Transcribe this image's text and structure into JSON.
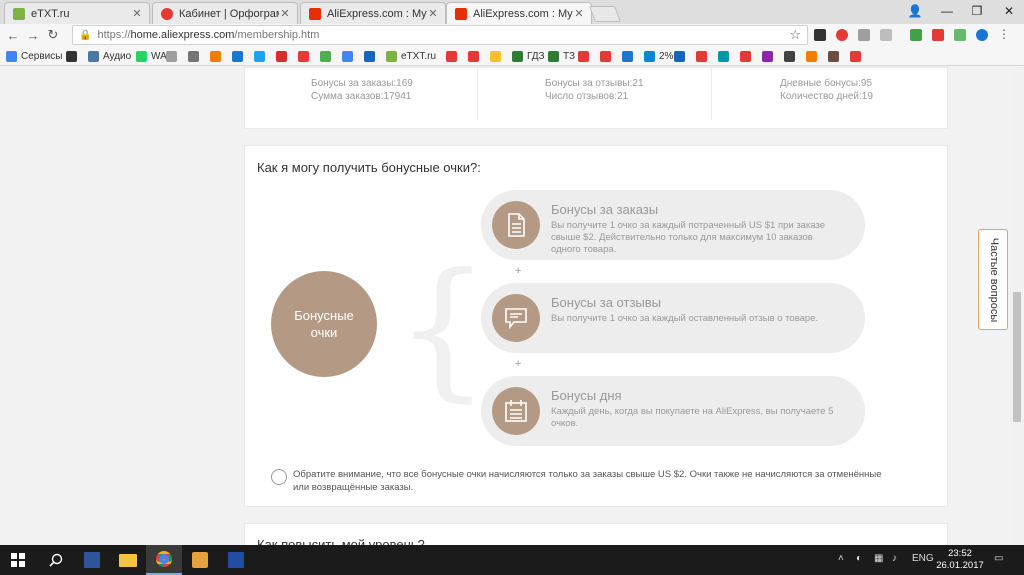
{
  "browser": {
    "tabs": [
      {
        "title": "eTXT.ru",
        "favicon_color": "#7cb342",
        "active": false
      },
      {
        "title": "Кабинет | Орфограммка",
        "favicon_color": "#e53935",
        "active": false
      },
      {
        "title": "AliExpress.com : My AliE",
        "favicon_color": "#e62e04",
        "active": false
      },
      {
        "title": "AliExpress.com : My AliE",
        "favicon_color": "#e62e04",
        "active": true
      }
    ],
    "address": {
      "scheme": "https://",
      "host": "home.aliexpress.com",
      "path": "/membership.htm"
    },
    "bookmarks": [
      {
        "label": "Сервисы",
        "color": "#4285f4"
      },
      {
        "label": "",
        "color": "#333333"
      },
      {
        "label": "Аудио",
        "color": "#4a76a8"
      },
      {
        "label": "WA",
        "color": "#25d366"
      },
      {
        "label": "",
        "color": "#9e9e9e"
      },
      {
        "label": "",
        "color": "#757575"
      },
      {
        "label": "",
        "color": "#f57c00"
      },
      {
        "label": "",
        "color": "#1976d2"
      },
      {
        "label": "",
        "color": "#1da1f2"
      },
      {
        "label": "",
        "color": "#d32f2f"
      },
      {
        "label": "",
        "color": "#e53935"
      },
      {
        "label": "",
        "color": "#4caf50"
      },
      {
        "label": "",
        "color": "#4285f4"
      },
      {
        "label": "",
        "color": "#1565c0"
      },
      {
        "label": "eTXT.ru",
        "color": "#7cb342"
      },
      {
        "label": "",
        "color": "#e53935"
      },
      {
        "label": "",
        "color": "#e53935"
      },
      {
        "label": "",
        "color": "#fbc02d"
      },
      {
        "label": "ГДЗ",
        "color": "#2e7d32"
      },
      {
        "label": "ТЗ",
        "color": "#2e7d32"
      },
      {
        "label": "",
        "color": "#e53935"
      },
      {
        "label": "",
        "color": "#e53935"
      },
      {
        "label": "",
        "color": "#1976d2"
      },
      {
        "label": "2%",
        "color": "#0288d1"
      },
      {
        "label": "",
        "color": "#1565c0"
      },
      {
        "label": "",
        "color": "#e53935"
      },
      {
        "label": "",
        "color": "#0097a7"
      },
      {
        "label": "",
        "color": "#e53935"
      },
      {
        "label": "",
        "color": "#8e24aa"
      },
      {
        "label": "",
        "color": "#424242"
      },
      {
        "label": "",
        "color": "#f57c00"
      },
      {
        "label": "",
        "color": "#6d4c41"
      },
      {
        "label": "",
        "color": "#e53935"
      }
    ]
  },
  "stats": {
    "col1": {
      "label1": "Бонусы за заказы:",
      "value1": "169",
      "label2": "Сумма заказов:",
      "value2": "17941"
    },
    "col2": {
      "label1": "Бонусы за отзывы:",
      "value1": "21",
      "label2": "Число отзывов:",
      "value2": "21"
    },
    "col3": {
      "label1": "Дневные бонусы:",
      "value1": "95",
      "label2": "Количество дней:",
      "value2": "19"
    }
  },
  "main": {
    "title": "Как я могу получить бонусные очки?:",
    "circle_line1": "Бонусные",
    "circle_line2": "очки",
    "plus": "+",
    "bonuses": [
      {
        "title": "Бонусы за заказы",
        "desc": "Вы получите 1 очко за каждый потраченный US $1 при заказе свыше $2. Действительно только для максимум 10 заказов одного товара.",
        "icon": "document-icon"
      },
      {
        "title": "Бонусы за отзывы",
        "desc": "Вы получите 1 очко за каждый оставленный отзыв о товаре.",
        "icon": "chat-bubble-icon"
      },
      {
        "title": "Бонусы дня",
        "desc": "Каждый день, когда вы покупаете на AliExpress, вы получаете 5 очков.",
        "icon": "calendar-icon"
      }
    ],
    "note": "Обратите внимание, что все бонусные очки начисляются только за заказы свыше US $2. Очки также не начисляются за отменённые или возвращённые заказы."
  },
  "next_section": {
    "title": "Как повысить мой уровень?"
  },
  "faq": {
    "label": "Частые вопросы"
  },
  "taskbar": {
    "lang": "ENG",
    "time": "23:52",
    "date": "26.01.2017"
  }
}
